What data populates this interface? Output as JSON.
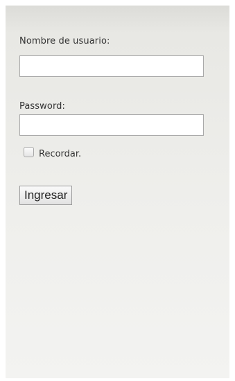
{
  "login_form": {
    "username": {
      "label": "Nombre de usuario:",
      "value": ""
    },
    "password": {
      "label": "Password:",
      "value": ""
    },
    "remember": {
      "label": "Recordar.",
      "checked": false
    },
    "submit_label": "Ingresar"
  }
}
